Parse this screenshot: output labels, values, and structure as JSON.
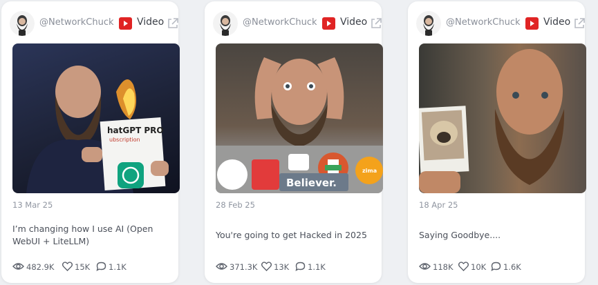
{
  "cards": [
    {
      "handle": "@NetworkChuck",
      "type_label": "Video",
      "date": "13 Mar 25",
      "title": "I’m changing how I use AI (Open WebUI + LiteLLM)",
      "views": "482.9K",
      "likes": "15K",
      "comments": "1.1K",
      "thumb_text_1": "hatGPT PRO",
      "thumb_text_2": "ubscription"
    },
    {
      "handle": "@NetworkChuck",
      "type_label": "Video",
      "date": "28 Feb 25",
      "title": "You're going to get Hacked in 2025",
      "views": "371.3K",
      "likes": "13K",
      "comments": "1.1K",
      "thumb_sticker": "Believer.",
      "thumb_sticker_2": "zima"
    },
    {
      "handle": "@NetworkChuck",
      "type_label": "Video",
      "date": "18 Apr 25",
      "title": "Saying Goodbye....",
      "views": "118K",
      "likes": "10K",
      "comments": "1.6K"
    }
  ],
  "colors": {
    "youtube": "#e02424",
    "muted_text": "#8a8f99",
    "card_bg": "#ffffff",
    "page_bg": "#eef0f3"
  },
  "icons": {
    "platform": "youtube-icon",
    "external": "external-link-icon",
    "views": "eye-icon",
    "likes": "heart-icon",
    "comments": "comment-icon"
  }
}
